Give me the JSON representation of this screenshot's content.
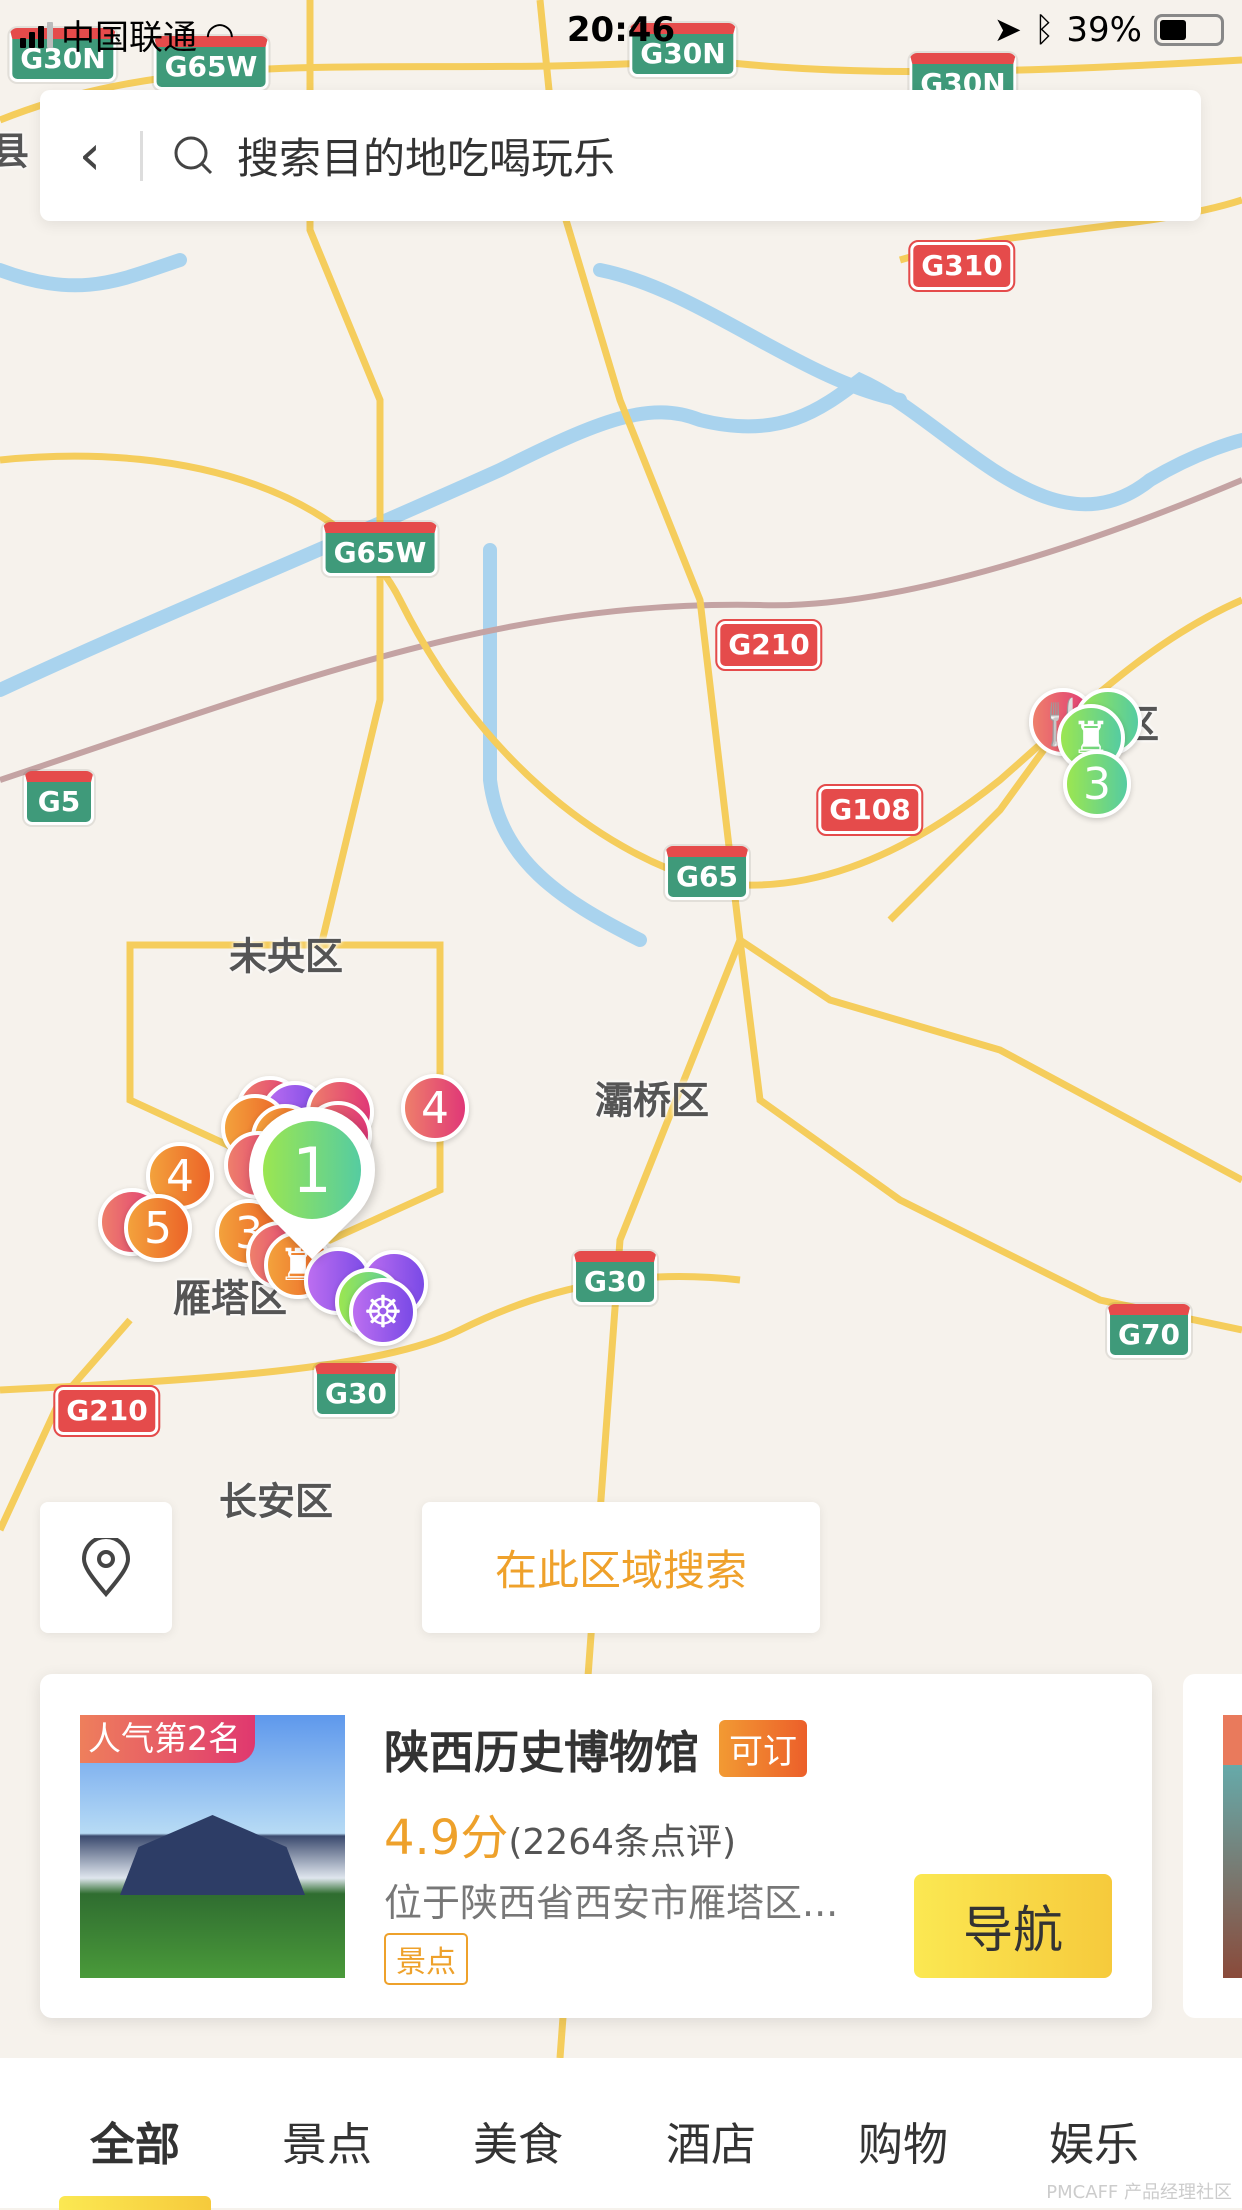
{
  "status_bar": {
    "carrier": "中国联通",
    "time": "20:46",
    "battery": "39%",
    "battery_level": 0.39
  },
  "search": {
    "placeholder": "搜索目的地吃喝玩乐"
  },
  "map": {
    "district_labels": [
      "未央区",
      "灞桥区",
      "雁塔区",
      "长安区",
      "区",
      "县"
    ],
    "highway_shields": [
      "G30N",
      "G65W",
      "G30N",
      "G30N",
      "G310",
      "G65W",
      "G210",
      "G5",
      "G108",
      "G65",
      "G30",
      "G70",
      "G210",
      "G30"
    ],
    "markers": [
      "4",
      "4",
      "5",
      "3",
      "1",
      "3"
    ],
    "selected_marker": "1"
  },
  "buttons": {
    "search_area": "在此区域搜索"
  },
  "card": {
    "rank_badge": "人气第2名",
    "title": "陕西历史博物馆",
    "bookable": "可订",
    "score": "4.9分",
    "reviews": "(2264条点评)",
    "address": "位于陕西省西安市雁塔区...",
    "tag": "景点",
    "navigate": "导航"
  },
  "tabs": [
    {
      "label": "全部",
      "active": true
    },
    {
      "label": "景点"
    },
    {
      "label": "美食"
    },
    {
      "label": "酒店"
    },
    {
      "label": "购物"
    },
    {
      "label": "娱乐"
    }
  ],
  "watermark": "PMCAFF 产品经理社区",
  "colors": {
    "accent": "#efa12b",
    "nav_yellow": "#f8d846",
    "highway_green": "#3f9a7a",
    "highway_red": "#e54b4b"
  }
}
